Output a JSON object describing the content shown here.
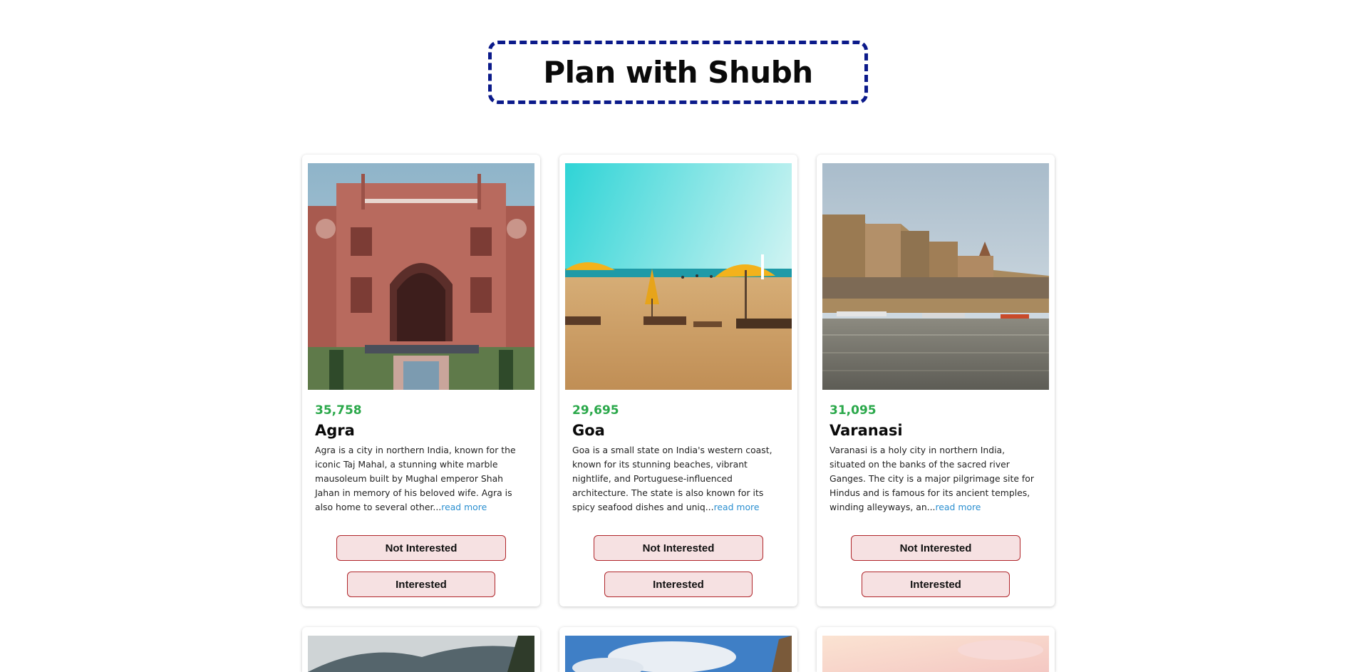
{
  "header": {
    "title": "Plan with Shubh"
  },
  "destinations": [
    {
      "price": "35,758",
      "name": "Agra",
      "description": "Agra is a city in northern India, known for the iconic Taj Mahal, a stunning white marble mausoleum built by Mughal emperor Shah Jahan in memory of his beloved wife. Agra is also home to several other...",
      "read_more": "read more",
      "not_interested_label": "Not Interested",
      "interested_label": "Interested"
    },
    {
      "price": "29,695",
      "name": "Goa",
      "description": "Goa is a small state on India's western coast, known for its stunning beaches, vibrant nightlife, and Portuguese-influenced architecture. The state is also known for its spicy seafood dishes and uniq...",
      "read_more": "read more",
      "not_interested_label": "Not Interested",
      "interested_label": "Interested"
    },
    {
      "price": "31,095",
      "name": "Varanasi",
      "description": "Varanasi is a holy city in northern India, situated on the banks of the sacred river Ganges. The city is a major pilgrimage site for Hindus and is famous for its ancient temples, winding alleyways, an...",
      "read_more": "read more",
      "not_interested_label": "Not Interested",
      "interested_label": "Interested"
    }
  ],
  "colors": {
    "title_border": "#0b1a8a",
    "price": "#2aa84a",
    "read_more": "#2b8fd0",
    "button_bg": "#f6e1e2",
    "button_border": "#b0262b"
  }
}
